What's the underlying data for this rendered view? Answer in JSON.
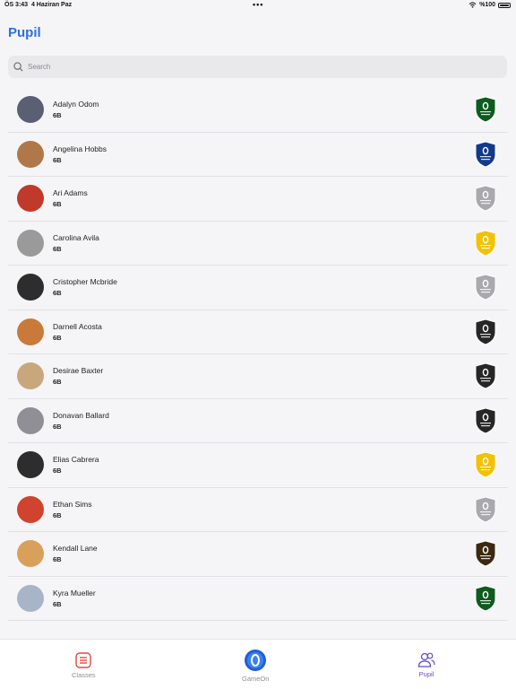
{
  "status": {
    "time": "ÖS 3:43",
    "date": "4 Haziran Paz",
    "battery": "%100"
  },
  "title": "Pupil",
  "search": {
    "placeholder": "Search",
    "value": ""
  },
  "pupils": [
    {
      "name": "Adalyn Odom",
      "class": "6B",
      "house": "Green House",
      "avatar": "raccoon",
      "avatar_color": "#5a5f73"
    },
    {
      "name": "Angelina Hobbs",
      "class": "6B",
      "house": "Blue House",
      "avatar": "bear",
      "avatar_color": "#b07848"
    },
    {
      "name": "Ari Adams",
      "class": "6B",
      "house": "White House",
      "avatar": "tribal-mask",
      "avatar_color": "#c0392b"
    },
    {
      "name": "Carolina Avila",
      "class": "6B",
      "house": "Yellow House",
      "avatar": "race-car",
      "avatar_color": "#9a9a9a"
    },
    {
      "name": "Cristopher Mcbride",
      "class": "6B",
      "house": "White House",
      "avatar": "boy",
      "avatar_color": "#2d2d2d"
    },
    {
      "name": "Darnell Acosta",
      "class": "6B",
      "house": "Black House",
      "avatar": "fox-basketball",
      "avatar_color": "#c97a3a"
    },
    {
      "name": "Desirae Baxter",
      "class": "6B",
      "house": "Black House",
      "avatar": "cat",
      "avatar_color": "#c9a77c"
    },
    {
      "name": "Donavan Ballard",
      "class": "6B",
      "house": "Black House",
      "avatar": "grey-cat",
      "avatar_color": "#8f8f95"
    },
    {
      "name": "Elias Cabrera",
      "class": "6B",
      "house": "Yellow House",
      "avatar": "boy",
      "avatar_color": "#2d2d2d"
    },
    {
      "name": "Ethan Sims",
      "class": "6B",
      "house": "White House",
      "avatar": "robot",
      "avatar_color": "#d0432e"
    },
    {
      "name": "Kendall Lane",
      "class": "6B",
      "house": "Brown House",
      "avatar": "fox",
      "avatar_color": "#d9a05b"
    },
    {
      "name": "Kyra Mueller",
      "class": "6B",
      "house": "Green House",
      "avatar": "elephant",
      "avatar_color": "#a8b4c8"
    }
  ],
  "house_colors": {
    "Green House": "#0d5b1e",
    "Blue House": "#123a8a",
    "White House": "#a9a9ad",
    "Yellow House": "#f2c200",
    "Black House": "#262626",
    "Brown House": "#3b2a10"
  },
  "tabs": [
    {
      "label": "Classes",
      "icon": "list-icon",
      "active": false
    },
    {
      "label": "GameOn",
      "icon": "gameon-logo",
      "active": false
    },
    {
      "label": "Pupil",
      "icon": "people-icon",
      "active": true
    }
  ]
}
